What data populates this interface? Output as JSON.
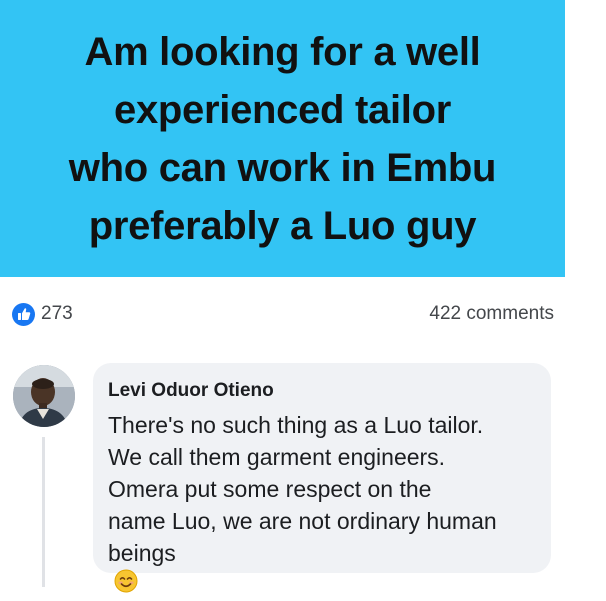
{
  "post": {
    "background_color": "#33c4f4",
    "text_lines": [
      "Am looking for a well",
      "experienced tailor",
      "who can work in Embu",
      "preferably a Luo guy"
    ]
  },
  "reactions": {
    "icon": "like-icon",
    "icon_color": "#1877f2",
    "count": "273",
    "comments_label": "422 comments"
  },
  "comment": {
    "author": "Levi Oduor Otieno",
    "avatar_icon": "avatar-photo",
    "lines": [
      "There's no such thing as a Luo tailor.",
      "We call them garment engineers.",
      "Omera put some respect on the",
      "name Luo, we are not ordinary human",
      "beings"
    ],
    "emoji": "smiling-face-emoji"
  }
}
